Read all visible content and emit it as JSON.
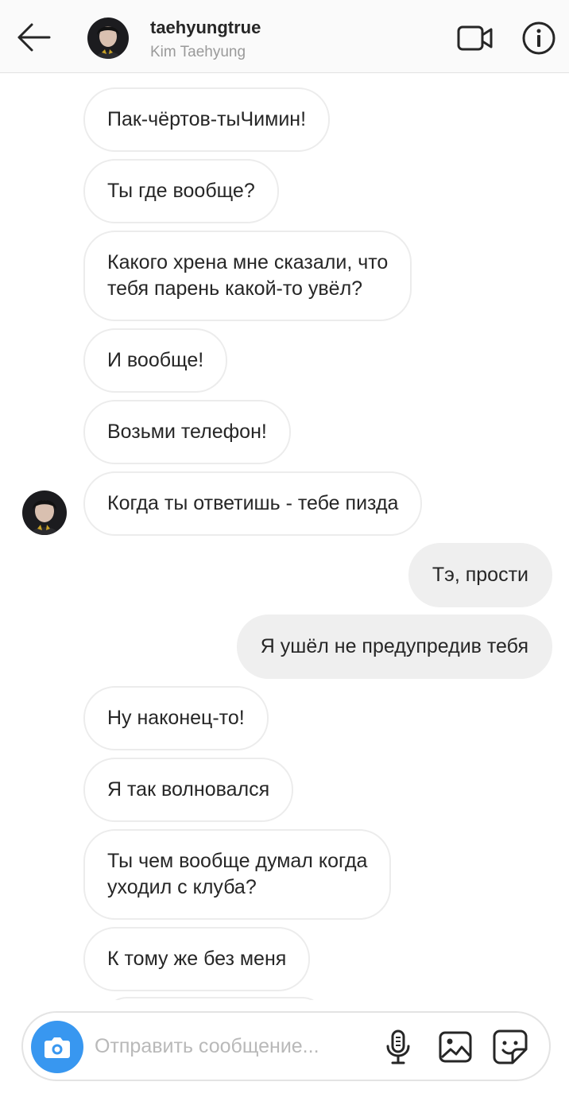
{
  "header": {
    "username": "taehyungtrue",
    "fullname": "Kim Taehyung"
  },
  "messages": [
    {
      "text": "Пак-чёртов-тыЧимин!",
      "side": "in"
    },
    {
      "text": "Ты где вообще?",
      "side": "in"
    },
    {
      "text": "Какого хрена мне сказали, что\nтебя парень какой-то увёл?",
      "side": "in"
    },
    {
      "text": "И вообще!",
      "side": "in"
    },
    {
      "text": "Возьми телефон!",
      "side": "in"
    },
    {
      "text": "Когда ты ответишь - тебе пизда",
      "side": "in",
      "with_avatar": true
    },
    {
      "text": "Тэ, прости",
      "side": "out"
    },
    {
      "text": "Я ушёл не предупредив тебя",
      "side": "out"
    },
    {
      "text": "Ну наконец-то!",
      "side": "in"
    },
    {
      "text": "Я так волновался",
      "side": "in"
    },
    {
      "text": "Ты чем вообще думал когда\nуходил с клуба?",
      "side": "in"
    },
    {
      "text": "К тому же без меня",
      "side": "in"
    }
  ],
  "composer": {
    "placeholder": "Отправить сообщение..."
  },
  "icons": {
    "back": "arrow-left-icon",
    "video": "video-camera-icon",
    "info": "info-icon",
    "camera": "camera-icon",
    "mic": "microphone-icon",
    "gallery": "gallery-icon",
    "sticker": "sticker-icon"
  },
  "colors": {
    "accent": "#3897f0",
    "incoming_border": "#ececec",
    "outgoing_bg": "#efefef"
  }
}
